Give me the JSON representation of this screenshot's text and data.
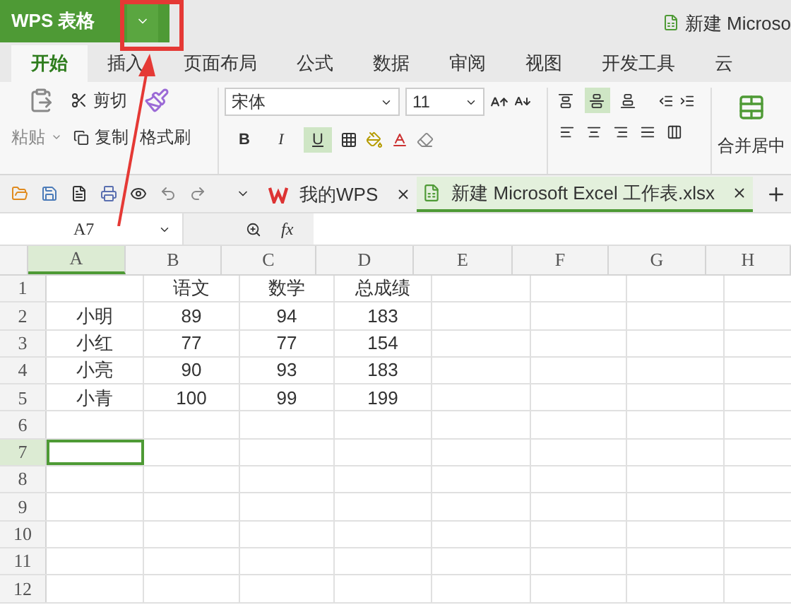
{
  "title_bar": {
    "app_name": "WPS 表格",
    "document_title": "新建 Microso"
  },
  "ribbon_tabs": [
    {
      "label": "开始",
      "selected": true
    },
    {
      "label": "插入",
      "selected": false
    },
    {
      "label": "页面布局",
      "selected": false
    },
    {
      "label": "公式",
      "selected": false
    },
    {
      "label": "数据",
      "selected": false
    },
    {
      "label": "审阅",
      "selected": false
    },
    {
      "label": "视图",
      "selected": false
    },
    {
      "label": "开发工具",
      "selected": false
    },
    {
      "label": "云",
      "selected": false
    }
  ],
  "ribbon": {
    "paste": "粘贴",
    "cut": "剪切",
    "copy": "复制",
    "format_painter": "格式刷",
    "font_family": "宋体",
    "font_size": "11",
    "style_buttons": [
      {
        "label": "B",
        "selected": false
      },
      {
        "label": "I",
        "selected": false
      },
      {
        "label": "U",
        "selected": true
      }
    ],
    "vertical_align": [
      {
        "kind": "top",
        "selected": false
      },
      {
        "kind": "middle",
        "selected": true
      },
      {
        "kind": "bottom",
        "selected": false
      }
    ],
    "merge": "合并居中"
  },
  "document_tabs": [
    {
      "label": "我的WPS",
      "selected": false
    },
    {
      "label": "新建 Microsoft Excel 工作表.xlsx",
      "selected": true
    }
  ],
  "formula_bar": {
    "name_box": "A7",
    "function_label": "fx"
  },
  "sheet": {
    "columns": [
      {
        "label": "A",
        "selected": true
      },
      {
        "label": "B",
        "selected": false
      },
      {
        "label": "C",
        "selected": false
      },
      {
        "label": "D",
        "selected": false
      },
      {
        "label": "E",
        "selected": false
      },
      {
        "label": "F",
        "selected": false
      },
      {
        "label": "G",
        "selected": false
      },
      {
        "label": "H",
        "selected": false
      }
    ],
    "rows": [
      {
        "label": "1",
        "selected": false,
        "cells": [
          null,
          "语文",
          "数学",
          "总成绩"
        ]
      },
      {
        "label": "2",
        "selected": false,
        "cells": [
          "小明",
          "89",
          "94",
          "183"
        ]
      },
      {
        "label": "3",
        "selected": false,
        "cells": [
          "小红",
          "77",
          "77",
          "154"
        ]
      },
      {
        "label": "4",
        "selected": false,
        "cells": [
          "小亮",
          "90",
          "93",
          "183"
        ]
      },
      {
        "label": "5",
        "selected": false,
        "cells": [
          "小青",
          "100",
          "99",
          "199"
        ]
      },
      {
        "label": "6",
        "selected": false,
        "cells": []
      },
      {
        "label": "7",
        "selected": true,
        "cells": []
      },
      {
        "label": "8",
        "selected": false,
        "cells": []
      },
      {
        "label": "9",
        "selected": false,
        "cells": []
      },
      {
        "label": "10",
        "selected": false,
        "cells": []
      },
      {
        "label": "11",
        "selected": false,
        "cells": []
      },
      {
        "label": "12",
        "selected": false,
        "cells": []
      }
    ]
  }
}
